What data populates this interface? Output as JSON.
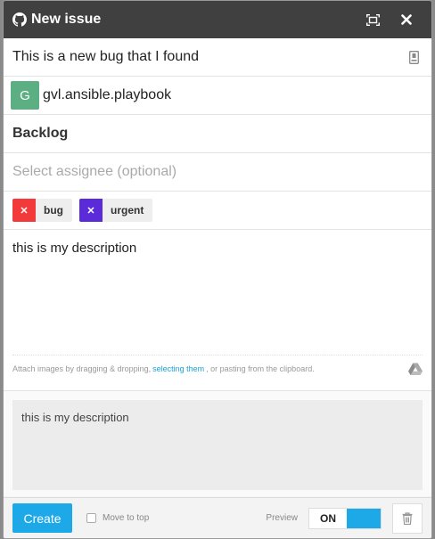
{
  "window": {
    "title": "New issue",
    "logo_icon": "github-icon",
    "expand_icon": "expand-icon",
    "close_icon": "close-icon"
  },
  "issue": {
    "title_value": "This is a new bug that I found",
    "template_icon": "document-icon"
  },
  "repo": {
    "avatar_letter": "G",
    "avatar_color": "#5cae83",
    "name": "gvl.ansible.playbook"
  },
  "milestone": "Backlog",
  "assignee": {
    "placeholder": "Select assignee (optional)"
  },
  "labels": [
    {
      "name": "bug",
      "color": "#f23a3a"
    },
    {
      "name": "urgent",
      "color": "#5b2bd9"
    }
  ],
  "description": {
    "value": "this is my description",
    "attach_text_before": "Attach images by dragging & dropping,",
    "attach_link": "selecting them",
    "attach_text_after": ", or pasting from the clipboard.",
    "drive_icon": "google-drive-icon"
  },
  "preview": {
    "text": "this is my description"
  },
  "footer": {
    "create_label": "Create",
    "move_to_top_label": "Move to top",
    "move_to_top_checked": false,
    "preview_label": "Preview",
    "toggle_label": "ON",
    "toggle_state": true,
    "accent_color": "#1da8e8",
    "trash_icon": "trash-icon"
  }
}
